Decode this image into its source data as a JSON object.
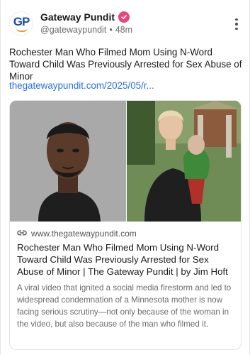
{
  "author": {
    "avatar_text": "GP",
    "name": "Gateway Pundit",
    "handle": "@gatewaypundit",
    "time": "48m",
    "verified_color": "#e8457a"
  },
  "post": {
    "text": "Rochester Man Who Filmed Mom Using N-Word Toward Child Was Previously Arrested for Sex Abuse of Minor",
    "link": "thegatewaypundit.com/2025/05/r..."
  },
  "card": {
    "domain": "www.thegatewaypundit.com",
    "title": "Rochester Man Who Filmed Mom Using N-Word Toward Child Was Previously Arrested for Sex Abuse of Minor | The Gateway Pundit | by Jim Hoft",
    "description": "A viral video that ignited a social media firestorm and led to widespread condemnation of a Minnesota mother is now facing serious scrutiny—not only because of the woman in the video, but also because of the man who filmed it."
  },
  "colors": {
    "link": "#2a6fdb",
    "muted": "#6b6b6b",
    "brand": "#1d4fa0"
  },
  "icons": [
    "more-options-icon",
    "link-icon",
    "verified-badge-icon"
  ]
}
